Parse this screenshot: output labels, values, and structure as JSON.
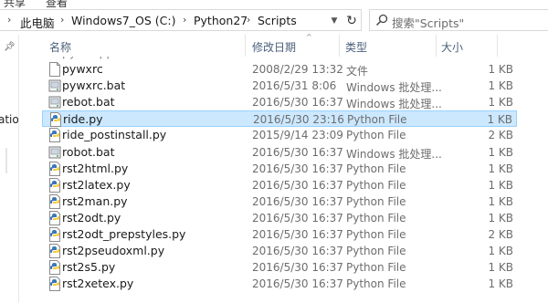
{
  "ribbon": {
    "left_tab": "共享",
    "right_tab": "查看"
  },
  "breadcrumb": {
    "items": [
      "此电脑",
      "Windows7_OS (C:)",
      "Python27",
      "Scripts"
    ]
  },
  "search": {
    "placeholder": "搜索\"Scripts\""
  },
  "nav": {
    "truncated_item": "ation"
  },
  "columns": {
    "name": "名称",
    "date": "修改日期",
    "type": "类型",
    "size": "大小"
  },
  "files": [
    {
      "name": "pywxrc",
      "date": "2008/2/29 13:32",
      "type": "文件",
      "size": "1 KB",
      "icon": "generic-file-icon",
      "selected": false
    },
    {
      "name": "pywxrc.bat",
      "date": "2016/5/31 8:06",
      "type": "Windows 批处理...",
      "size": "1 KB",
      "icon": "batch-file-icon",
      "selected": false
    },
    {
      "name": "rebot.bat",
      "date": "2016/5/30 16:37",
      "type": "Windows 批处理...",
      "size": "1 KB",
      "icon": "batch-file-icon",
      "selected": false
    },
    {
      "name": "ride.py",
      "date": "2016/5/30 23:16",
      "type": "Python File",
      "size": "1 KB",
      "icon": "python-file-icon",
      "selected": true
    },
    {
      "name": "ride_postinstall.py",
      "date": "2015/9/14 23:09",
      "type": "Python File",
      "size": "2 KB",
      "icon": "python-file-icon",
      "selected": false
    },
    {
      "name": "robot.bat",
      "date": "2016/5/30 16:37",
      "type": "Windows 批处理...",
      "size": "1 KB",
      "icon": "batch-file-icon",
      "selected": false
    },
    {
      "name": "rst2html.py",
      "date": "2016/5/30 16:37",
      "type": "Python File",
      "size": "1 KB",
      "icon": "python-file-icon",
      "selected": false
    },
    {
      "name": "rst2latex.py",
      "date": "2016/5/30 16:37",
      "type": "Python File",
      "size": "1 KB",
      "icon": "python-file-icon",
      "selected": false
    },
    {
      "name": "rst2man.py",
      "date": "2016/5/30 16:37",
      "type": "Python File",
      "size": "1 KB",
      "icon": "python-file-icon",
      "selected": false
    },
    {
      "name": "rst2odt.py",
      "date": "2016/5/30 16:37",
      "type": "Python File",
      "size": "1 KB",
      "icon": "python-file-icon",
      "selected": false
    },
    {
      "name": "rst2odt_prepstyles.py",
      "date": "2016/5/30 16:37",
      "type": "Python File",
      "size": "2 KB",
      "icon": "python-file-icon",
      "selected": false
    },
    {
      "name": "rst2pseudoxml.py",
      "date": "2016/5/30 16:37",
      "type": "Python File",
      "size": "1 KB",
      "icon": "python-file-icon",
      "selected": false
    },
    {
      "name": "rst2s5.py",
      "date": "2016/5/30 16:37",
      "type": "Python File",
      "size": "1 KB",
      "icon": "python-file-icon",
      "selected": false
    },
    {
      "name": "rst2xetex.py",
      "date": "2016/5/30 16:37",
      "type": "Python File",
      "size": "1 KB",
      "icon": "python-file-icon",
      "selected": false
    }
  ],
  "colors": {
    "selected_bg": "#cce8ff",
    "selected_border": "#99d1ff",
    "header_text": "#4c607a",
    "meta_text": "#6d6d6d"
  }
}
